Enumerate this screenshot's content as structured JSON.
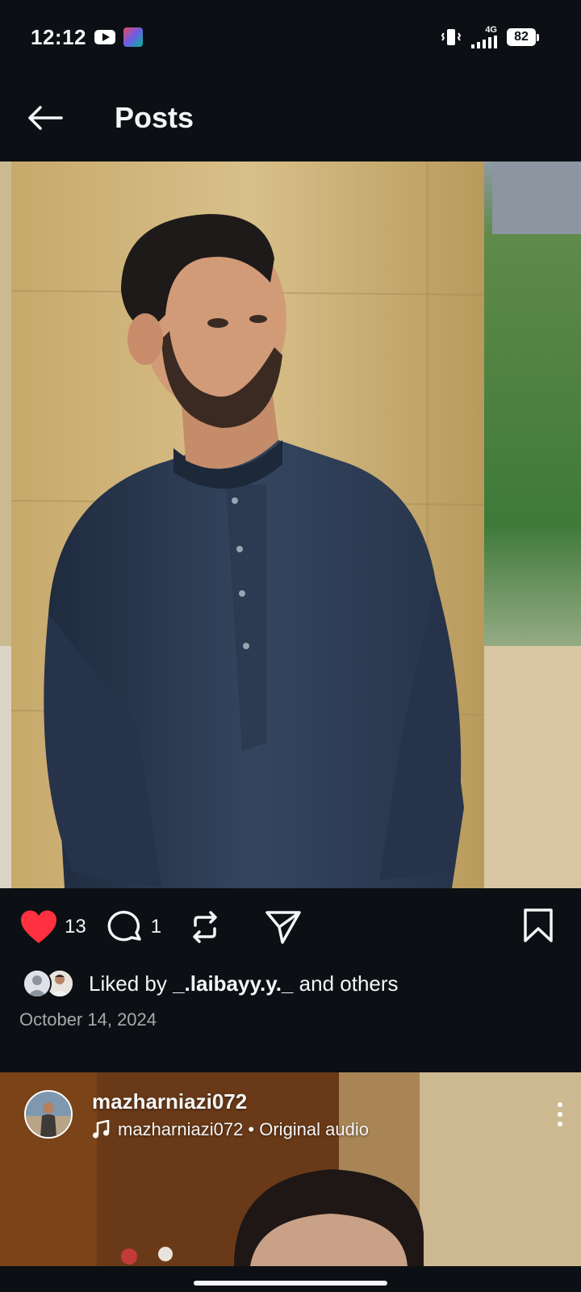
{
  "status_bar": {
    "time": "12:12",
    "network": "4G",
    "battery": "82",
    "icons": [
      "youtube-icon",
      "app-notification-icon",
      "vibrate-icon",
      "signal-icon",
      "battery-icon"
    ]
  },
  "header": {
    "title": "Posts",
    "back_icon": "arrow-left-icon"
  },
  "post": {
    "likes_count": "13",
    "comments_count": "1",
    "liked_by_prefix": "Liked by ",
    "liked_by_user": "_.laibayy.y._",
    "liked_by_suffix": " and others",
    "date": "October 14, 2024",
    "icons": [
      "heart-filled-icon",
      "comment-icon",
      "repost-icon",
      "share-icon",
      "bookmark-icon"
    ]
  },
  "next_post": {
    "username": "mazharniazi072",
    "audio": "mazharniazi072 • Original audio",
    "icons": [
      "music-note-icon",
      "more-vertical-icon"
    ]
  },
  "colors": {
    "background": "#0c1014",
    "text": "#f5f5f5",
    "secondary_text": "#a8a8a8",
    "like_red": "#ff3040"
  }
}
